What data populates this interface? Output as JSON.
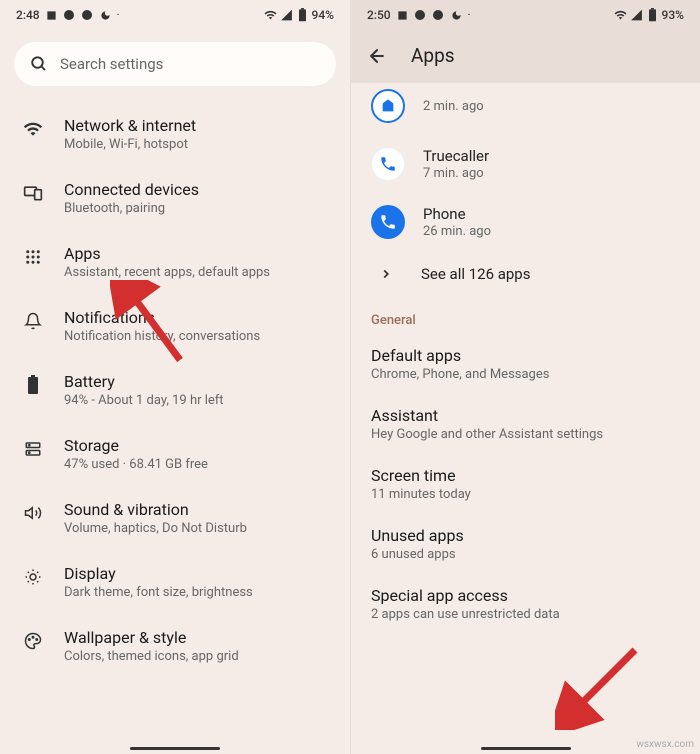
{
  "left": {
    "status": {
      "time": "2:48",
      "battery": "94%"
    },
    "search": {
      "placeholder": "Search settings"
    },
    "items": [
      {
        "icon": "wifi",
        "title": "Network & internet",
        "subtitle": "Mobile, Wi-Fi, hotspot"
      },
      {
        "icon": "devices",
        "title": "Connected devices",
        "subtitle": "Bluetooth, pairing"
      },
      {
        "icon": "apps",
        "title": "Apps",
        "subtitle": "Assistant, recent apps, default apps"
      },
      {
        "icon": "bell",
        "title": "Notifications",
        "subtitle": "Notification history, conversations"
      },
      {
        "icon": "battery",
        "title": "Battery",
        "subtitle": "94% - About 1 day, 19 hr left"
      },
      {
        "icon": "storage",
        "title": "Storage",
        "subtitle": "47% used · 68.41 GB free"
      },
      {
        "icon": "sound",
        "title": "Sound & vibration",
        "subtitle": "Volume, haptics, Do Not Disturb"
      },
      {
        "icon": "display",
        "title": "Display",
        "subtitle": "Dark theme, font size, brightness"
      },
      {
        "icon": "wallpaper",
        "title": "Wallpaper & style",
        "subtitle": "Colors, themed icons, app grid"
      }
    ]
  },
  "right": {
    "status": {
      "time": "2:50",
      "battery": "93%"
    },
    "header": {
      "title": "Apps"
    },
    "recent": [
      {
        "name": "",
        "sub": "2 min. ago",
        "iconType": "ring"
      },
      {
        "name": "Truecaller",
        "sub": "7 min. ago",
        "iconType": "white"
      },
      {
        "name": "Phone",
        "sub": "26 min. ago",
        "iconType": "blue"
      }
    ],
    "seeAll": "See all 126 apps",
    "generalLabel": "General",
    "general": [
      {
        "title": "Default apps",
        "subtitle": "Chrome, Phone, and Messages"
      },
      {
        "title": "Assistant",
        "subtitle": "Hey Google and other Assistant settings"
      },
      {
        "title": "Screen time",
        "subtitle": "11 minutes today"
      },
      {
        "title": "Unused apps",
        "subtitle": "6 unused apps"
      },
      {
        "title": "Special app access",
        "subtitle": "2 apps can use unrestricted data"
      }
    ]
  },
  "watermark": "wsxwsx.com"
}
